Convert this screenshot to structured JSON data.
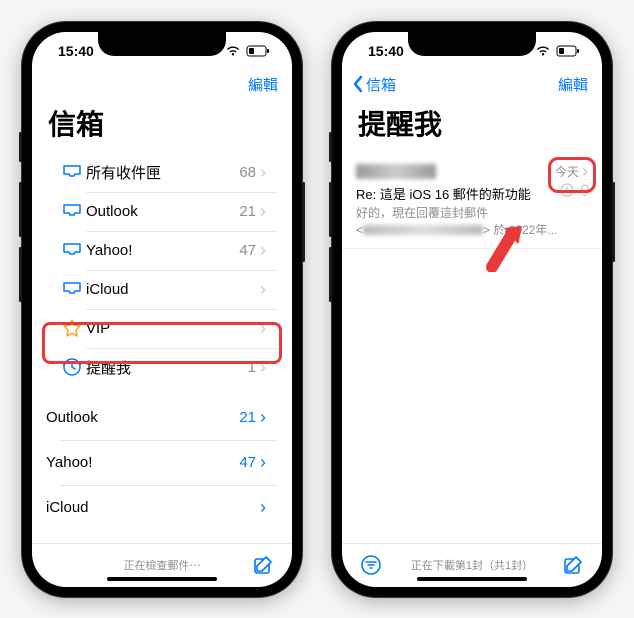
{
  "status": {
    "time": "15:40"
  },
  "nav": {
    "back": "信箱",
    "edit": "編輯"
  },
  "left": {
    "title": "信箱",
    "mailboxes": [
      {
        "icon": "tray",
        "label": "所有收件匣",
        "count": "68"
      },
      {
        "icon": "tray",
        "label": "Outlook",
        "count": "21"
      },
      {
        "icon": "tray",
        "label": "Yahoo!",
        "count": "47"
      },
      {
        "icon": "tray",
        "label": "iCloud",
        "count": ""
      },
      {
        "icon": "star",
        "label": "VIP",
        "count": ""
      },
      {
        "icon": "clock",
        "label": "提醒我",
        "count": "1"
      }
    ],
    "accounts": [
      {
        "label": "Outlook",
        "count": "21"
      },
      {
        "label": "Yahoo!",
        "count": "47"
      },
      {
        "label": "iCloud",
        "count": ""
      }
    ],
    "footer": "正在檢查郵件⋯"
  },
  "right": {
    "title": "提醒我",
    "message": {
      "time": "今天",
      "subject": "Re: 這是 iOS 16 郵件的新功能",
      "preview1": "好的，現在回覆這封郵件",
      "preview3": "於 2022年..."
    },
    "footer": "正在下載第1封（共1封）"
  }
}
